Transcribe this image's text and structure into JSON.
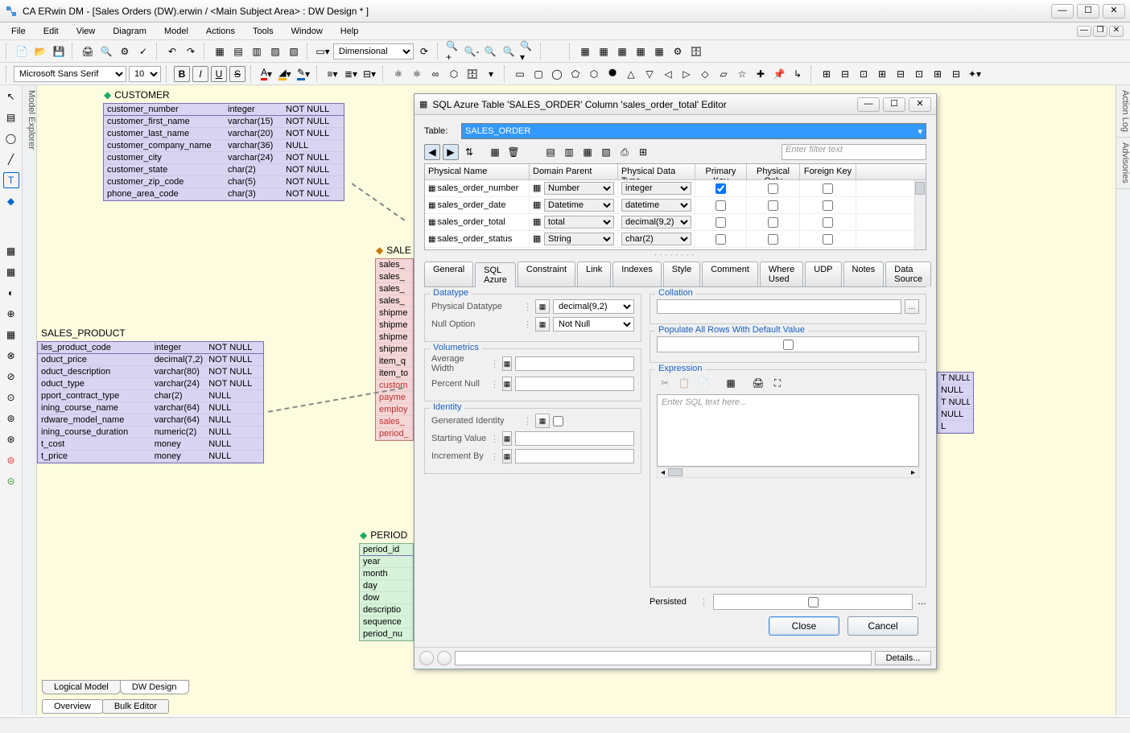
{
  "app": {
    "title": "CA ERwin DM - [Sales Orders (DW).erwin / <Main Subject Area> : DW Design * ]"
  },
  "menu": [
    "File",
    "Edit",
    "View",
    "Diagram",
    "Model",
    "Actions",
    "Tools",
    "Window",
    "Help"
  ],
  "toolbar1": {
    "dimensional": "Dimensional",
    "font_name": "Microsoft Sans Serif",
    "font_size": "10"
  },
  "side_tabs": {
    "left": "Model Explorer",
    "right_top": "Action Log",
    "right_bottom": "Advisories"
  },
  "entities": {
    "customer": {
      "title": "CUSTOMER",
      "rows": [
        {
          "name": "customer_number",
          "type": "integer",
          "null": "NOT NULL",
          "pk": true
        },
        {
          "name": "customer_first_name",
          "type": "varchar(15)",
          "null": "NOT NULL"
        },
        {
          "name": "customer_last_name",
          "type": "varchar(20)",
          "null": "NOT NULL"
        },
        {
          "name": "customer_company_name",
          "type": "varchar(36)",
          "null": "NULL"
        },
        {
          "name": "customer_city",
          "type": "varchar(24)",
          "null": "NOT NULL"
        },
        {
          "name": "customer_state",
          "type": "char(2)",
          "null": "NOT NULL"
        },
        {
          "name": "customer_zip_code",
          "type": "char(5)",
          "null": "NOT NULL"
        },
        {
          "name": "phone_area_code",
          "type": "char(3)",
          "null": "NOT NULL"
        }
      ]
    },
    "sales_product": {
      "title": "SALES_PRODUCT",
      "rows": [
        {
          "name": "les_product_code",
          "type": "integer",
          "null": "NOT NULL",
          "pk": true
        },
        {
          "name": "oduct_price",
          "type": "decimal(7,2)",
          "null": "NOT NULL"
        },
        {
          "name": "oduct_description",
          "type": "varchar(80)",
          "null": "NOT NULL"
        },
        {
          "name": "oduct_type",
          "type": "varchar(24)",
          "null": "NOT NULL"
        },
        {
          "name": "pport_contract_type",
          "type": "char(2)",
          "null": "NULL"
        },
        {
          "name": "ining_course_name",
          "type": "varchar(64)",
          "null": "NULL"
        },
        {
          "name": "rdware_model_name",
          "type": "varchar(64)",
          "null": "NULL"
        },
        {
          "name": "ining_course_duration",
          "type": "numeric(2)",
          "null": "NULL"
        },
        {
          "name": "t_cost",
          "type": "money",
          "null": "NULL"
        },
        {
          "name": "t_price",
          "type": "money",
          "null": "NULL"
        }
      ]
    },
    "sales_order": {
      "title": "SALE",
      "rows": [
        {
          "name": "sales_"
        },
        {
          "name": "sales_"
        },
        {
          "name": "sales_"
        },
        {
          "name": "sales_"
        },
        {
          "name": "shipme"
        },
        {
          "name": "shipme"
        },
        {
          "name": "shipme"
        },
        {
          "name": "shipme"
        },
        {
          "name": "item_q"
        },
        {
          "name": "item_to"
        },
        {
          "name": "custom",
          "fk": true
        },
        {
          "name": "payme",
          "fk": true
        },
        {
          "name": "employ",
          "fk": true
        },
        {
          "name": "sales_",
          "fk": true
        },
        {
          "name": "period_",
          "fk": true
        }
      ]
    },
    "period": {
      "title": "PERIOD",
      "rows": [
        {
          "name": "period_id",
          "pk": true
        },
        {
          "name": "year"
        },
        {
          "name": "month"
        },
        {
          "name": "day"
        },
        {
          "name": "dow"
        },
        {
          "name": "descriptio"
        },
        {
          "name": "sequence"
        },
        {
          "name": "period_nu"
        }
      ]
    },
    "right_partial": {
      "rows": [
        {
          "null": "T NULL"
        },
        {
          "null": "NULL"
        },
        {
          "null": "T NULL"
        },
        {
          "null": "NULL"
        },
        {
          "null": "L"
        }
      ]
    }
  },
  "dialog": {
    "title": "SQL Azure Table 'SALES_ORDER' Column 'sales_order_total' Editor",
    "table_label": "Table:",
    "table_value": "SALES_ORDER",
    "filter_placeholder": "Enter filter text",
    "grid_headers": [
      "Physical Name",
      "Domain Parent",
      "Physical Data Type",
      "Primary Key",
      "Physical Only",
      "Foreign Key"
    ],
    "grid_rows": [
      {
        "name": "sales_order_number",
        "domain": "Number",
        "dt": "integer",
        "pk": true,
        "po": false,
        "fk": false
      },
      {
        "name": "sales_order_date",
        "domain": "Datetime",
        "dt": "datetime",
        "pk": false,
        "po": false,
        "fk": false
      },
      {
        "name": "sales_order_total",
        "domain": "total",
        "dt": "decimal(9,2)",
        "pk": false,
        "po": false,
        "fk": false
      },
      {
        "name": "sales_order_status",
        "domain": "String",
        "dt": "char(2)",
        "pk": false,
        "po": false,
        "fk": false
      }
    ],
    "tabs": [
      "General",
      "SQL Azure",
      "Constraint",
      "Link",
      "Indexes",
      "Style",
      "Comment",
      "Where Used",
      "UDP",
      "Notes",
      "Data Source"
    ],
    "active_tab": "SQL Azure",
    "datatype_legend": "Datatype",
    "physical_datatype_label": "Physical Datatype",
    "physical_datatype_value": "decimal(9,2)",
    "null_option_label": "Null Option",
    "null_option_value": "Not Null",
    "volumetrics_legend": "Volumetrics",
    "avg_width_label": "Average Width",
    "percent_null_label": "Percent Null",
    "identity_legend": "Identity",
    "generated_identity_label": "Generated Identity",
    "starting_value_label": "Starting Value",
    "increment_by_label": "Increment By",
    "collation_legend": "Collation",
    "populate_legend": "Populate All Rows With Default Value",
    "expression_legend": "Expression",
    "expression_placeholder": "Enter SQL text here...",
    "persisted_label": "Persisted",
    "close_label": "Close",
    "cancel_label": "Cancel",
    "details_label": "Details..."
  },
  "bottom_tabs": {
    "row1": [
      "Logical Model",
      "DW Design"
    ],
    "row2": [
      "Overview",
      "Bulk Editor"
    ]
  }
}
